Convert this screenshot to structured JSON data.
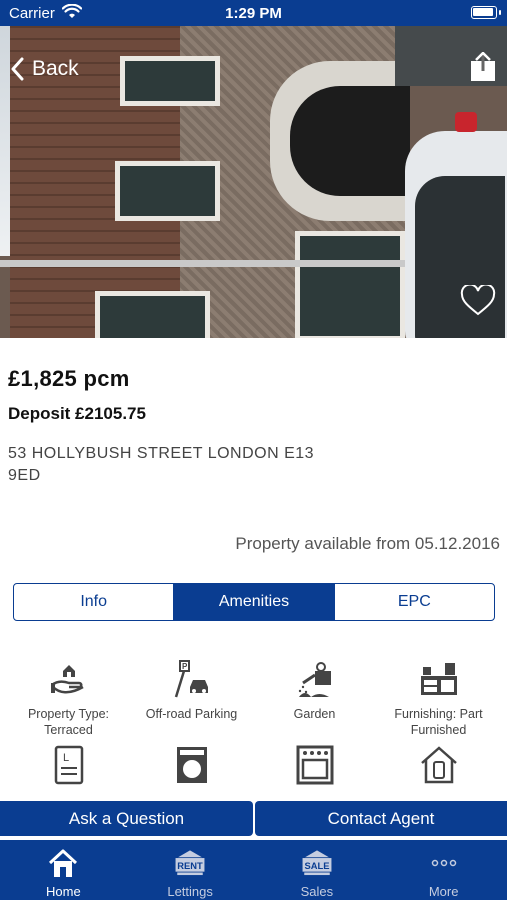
{
  "status_bar": {
    "carrier": "Carrier",
    "time": "1:29 PM"
  },
  "nav": {
    "back_label": "Back"
  },
  "property": {
    "price": "£1,825 pcm",
    "deposit": "Deposit £2105.75",
    "address": "53 HOLLYBUSH STREET LONDON E13 9ED",
    "availability": "Property available from 05.12.2016"
  },
  "tabs": [
    {
      "label": "Info",
      "active": false
    },
    {
      "label": "Amenities",
      "active": true
    },
    {
      "label": "EPC",
      "active": false
    }
  ],
  "amenities": [
    {
      "label": "Property Type: Terraced",
      "icon": "house-in-hand-icon"
    },
    {
      "label": "Off-road Parking",
      "icon": "parking-icon"
    },
    {
      "label": "Garden",
      "icon": "watering-can-icon"
    },
    {
      "label": "Furnishing: Part Furnished",
      "icon": "furniture-icon"
    },
    {
      "label": "",
      "icon": "document-icon"
    },
    {
      "label": "",
      "icon": "washing-machine-icon"
    },
    {
      "label": "",
      "icon": "oven-icon"
    },
    {
      "label": "",
      "icon": "house-thermostat-icon"
    }
  ],
  "actions": {
    "ask_question": "Ask a Question",
    "contact_agent": "Contact Agent"
  },
  "tab_bar": [
    {
      "label": "Home",
      "icon": "home-icon",
      "active": true,
      "badge": ""
    },
    {
      "label": "Lettings",
      "icon": "rent-sign-icon",
      "active": false,
      "badge": "RENT"
    },
    {
      "label": "Sales",
      "icon": "sale-sign-icon",
      "active": false,
      "badge": "SALE"
    },
    {
      "label": "More",
      "icon": "more-dots-icon",
      "active": false,
      "badge": ""
    }
  ],
  "colors": {
    "brand": "#0a3d91",
    "text": "#111111",
    "muted": "#555555"
  }
}
